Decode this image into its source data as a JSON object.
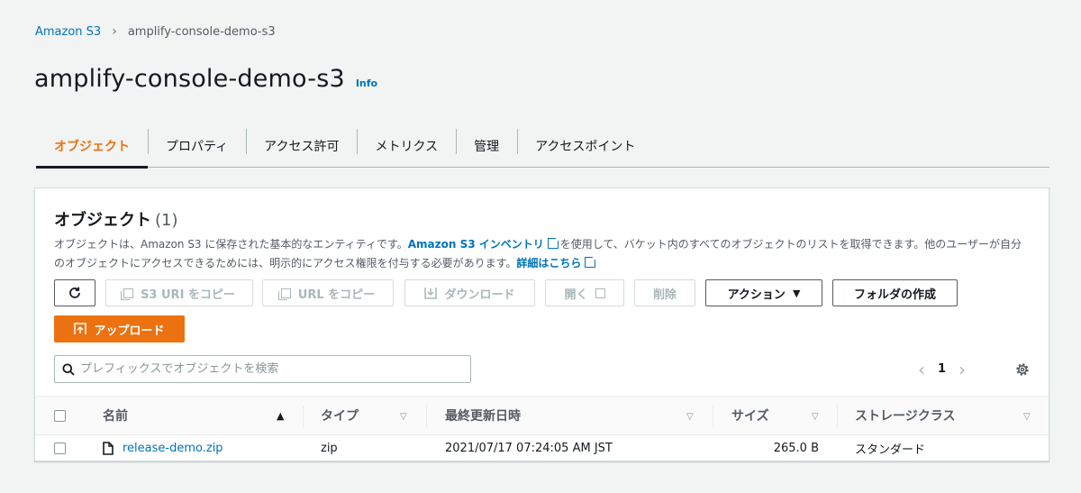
{
  "breadcrumb": {
    "root": "Amazon S3",
    "current": "amplify-console-demo-s3"
  },
  "page": {
    "title": "amplify-console-demo-s3",
    "info": "Info"
  },
  "tabs": [
    {
      "label": "オブジェクト",
      "active": true
    },
    {
      "label": "プロパティ",
      "active": false
    },
    {
      "label": "アクセス許可",
      "active": false
    },
    {
      "label": "メトリクス",
      "active": false
    },
    {
      "label": "管理",
      "active": false
    },
    {
      "label": "アクセスポイント",
      "active": false
    }
  ],
  "panel": {
    "title": "オブジェクト",
    "count": "(1)",
    "desc_1": "オブジェクトは、Amazon S3 に保存された基本的なエンティティです。",
    "desc_link1": "Amazon S3 インベントリ",
    "desc_2": "を使用して、バケット内のすべてのオブジェクトのリストを取得できます。他のユーザーが自分のオブジェクトにアクセスできるためには、明示的にアクセス権限を付与する必要があります。",
    "desc_link2": "詳細はこちら"
  },
  "toolbar": {
    "refresh": "refresh",
    "copy_s3_uri": "S3 URI をコピー",
    "copy_url": "URL をコピー",
    "download": "ダウンロード",
    "open": "開く",
    "delete": "削除",
    "actions": "アクション",
    "create_folder": "フォルダの作成",
    "upload": "アップロード"
  },
  "search": {
    "placeholder": "プレフィックスでオブジェクトを検索"
  },
  "pagination": {
    "page": "1"
  },
  "table": {
    "columns": [
      "名前",
      "タイプ",
      "最終更新日時",
      "サイズ",
      "ストレージクラス"
    ],
    "rows": [
      {
        "name": "release-demo.zip",
        "type": "zip",
        "modified": "2021/07/17 07:24:05 AM JST",
        "size": "265.0 B",
        "storage": "スタンダード"
      }
    ]
  },
  "colors": {
    "accent": "#ec7211",
    "link": "#0073bb",
    "text": "#16191f",
    "muted": "#545b64"
  }
}
